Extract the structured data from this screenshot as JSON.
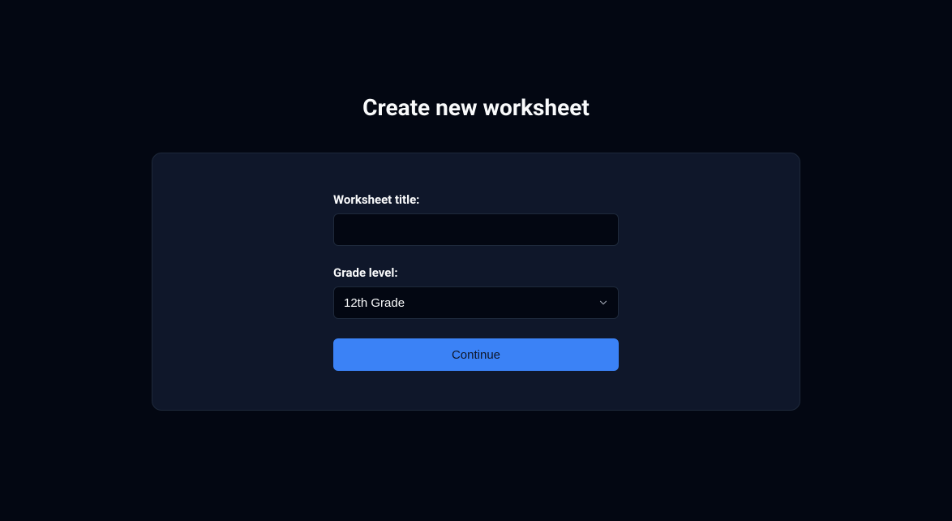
{
  "page": {
    "title": "Create new worksheet"
  },
  "form": {
    "title_label": "Worksheet title:",
    "title_value": "",
    "grade_label": "Grade level:",
    "grade_selected": "12th Grade",
    "continue_label": "Continue"
  }
}
